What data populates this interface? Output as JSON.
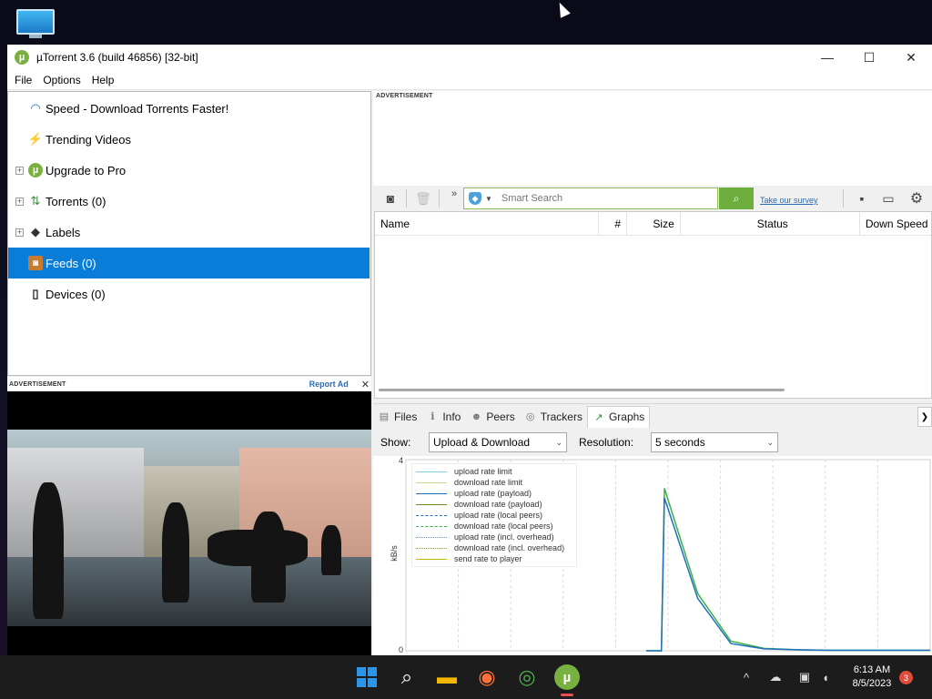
{
  "window": {
    "title": "µTorrent 3.6  (build 46856) [32-bit]",
    "logo_letter": "µ",
    "controls": {
      "minimize": "—",
      "maximize": "☐",
      "close": "✕"
    }
  },
  "menu": [
    "File",
    "Options",
    "Help"
  ],
  "sidebar": {
    "items": [
      {
        "label": "Speed - Download Torrents Faster!",
        "icon": "speedometer-icon",
        "glyph": "◠",
        "expander": ""
      },
      {
        "label": "Trending Videos",
        "icon": "lightning-icon",
        "glyph": "⚡",
        "expander": ""
      },
      {
        "label": "Upgrade to Pro",
        "icon": "utorrent-icon",
        "glyph": "µ",
        "expander": "+"
      },
      {
        "label": "Torrents (0)",
        "icon": "updown-arrows-icon",
        "glyph": "⇅",
        "expander": "+"
      },
      {
        "label": "Labels",
        "icon": "tag-icon",
        "glyph": "◆",
        "expander": "+"
      },
      {
        "label": "Feeds (0)",
        "icon": "rss-icon",
        "glyph": "◙",
        "expander": ""
      },
      {
        "label": "Devices (0)",
        "icon": "phone-icon",
        "glyph": "▯",
        "expander": ""
      }
    ],
    "selected_index": 5
  },
  "left_ad": {
    "tag": "ADVERTISEMENT",
    "report": "Report Ad",
    "close": "✕"
  },
  "top_ad": {
    "tag": "ADVERTISEMENT"
  },
  "toolbar": {
    "rss_glyph": "◙",
    "trash_glyph": "🗑",
    "more_glyph": "»",
    "search_placeholder": "Smart Search",
    "search_btn_glyph": "⌕",
    "survey_link": "Take our survey",
    "chat_glyph": "▪",
    "monitor_glyph": "▭",
    "gear_glyph": "⚙"
  },
  "table": {
    "columns": [
      "Name",
      "#",
      "Size",
      "Status",
      "Down Speed"
    ]
  },
  "tabs": [
    {
      "label": "Files",
      "glyph": "▤",
      "active": false
    },
    {
      "label": "Info",
      "glyph": "ℹ",
      "active": false
    },
    {
      "label": "Peers",
      "glyph": "☻",
      "active": false
    },
    {
      "label": "Trackers",
      "glyph": "◎",
      "active": false
    },
    {
      "label": "Graphs",
      "glyph": "↗",
      "active": true
    }
  ],
  "tab_more": "❯",
  "graph_options": {
    "show_label": "Show:",
    "show_value": "Upload & Download",
    "resolution_label": "Resolution:",
    "resolution_value": "5 seconds",
    "caret": "⌄"
  },
  "chart_data": {
    "type": "line",
    "ylabel": "kB/s",
    "ylim": [
      0,
      4
    ],
    "yticks": [
      "4",
      "0"
    ],
    "legend": [
      {
        "name": "upload rate limit",
        "color": "#7fd0e8",
        "dash": "solid"
      },
      {
        "name": "download rate limit",
        "color": "#c7d98a",
        "dash": "solid"
      },
      {
        "name": "upload rate (payload)",
        "color": "#1f6fc0",
        "dash": "solid"
      },
      {
        "name": "download rate (payload)",
        "color": "#6b8e23",
        "dash": "solid"
      },
      {
        "name": "upload rate (local peers)",
        "color": "#1f6fc0",
        "dash": "dash"
      },
      {
        "name": "download rate (local peers)",
        "color": "#3cb043",
        "dash": "dash"
      },
      {
        "name": "upload rate (incl. overhead)",
        "color": "#7a9ab8",
        "dash": "dot"
      },
      {
        "name": "download rate (incl. overhead)",
        "color": "#8a9a5a",
        "dash": "dot"
      },
      {
        "name": "send rate to player",
        "color": "#c8b400",
        "dash": "solid"
      }
    ],
    "series": [
      {
        "name": "download rate (payload)",
        "values": [
          0,
          0,
          0,
          0,
          0,
          0,
          3.4,
          1.2,
          0.2,
          0.05,
          0.02,
          0.01,
          0.01,
          0.01,
          0.01
        ]
      },
      {
        "name": "upload rate (payload)",
        "values": [
          0,
          0,
          0,
          0,
          0,
          0,
          3.2,
          1.1,
          0.15,
          0.04,
          0.02,
          0.01,
          0.01,
          0.01,
          0.01
        ]
      }
    ]
  },
  "taskbar": {
    "apps": [
      {
        "name": "start-button",
        "glyph": ""
      },
      {
        "name": "search-button",
        "glyph": "⌕"
      },
      {
        "name": "file-explorer-button",
        "glyph": "▬"
      },
      {
        "name": "firefox-button",
        "glyph": "◉"
      },
      {
        "name": "chrome-button",
        "glyph": "◎"
      },
      {
        "name": "utorrent-taskbar-button",
        "glyph": "µ"
      }
    ],
    "tray": {
      "chevron": "^",
      "network": "☁",
      "display": "▣",
      "volume": "◖"
    },
    "time": "6:13 AM",
    "date": "8/5/2023",
    "notifications": "3"
  }
}
